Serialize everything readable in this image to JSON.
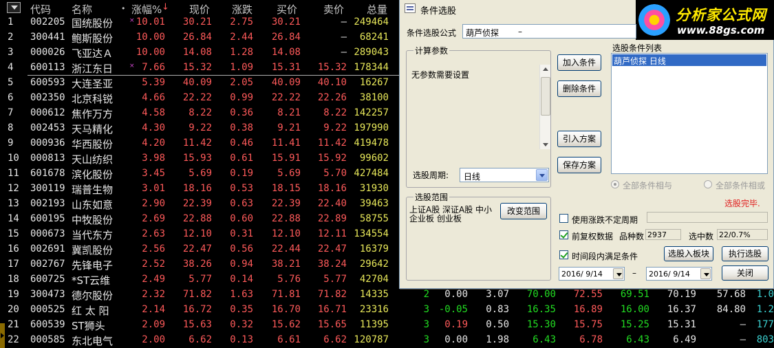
{
  "table": {
    "headers": {
      "code": "代码",
      "name": "名称",
      "dot": "•",
      "change_pct": "涨幅%",
      "price": "现价",
      "change": "涨跌",
      "bid": "买价",
      "ask": "卖价",
      "volume": "总量"
    },
    "rows": [
      {
        "no": "1",
        "code": "002205",
        "name": "国统股份",
        "mark": "×",
        "pct": "10.01",
        "price": "30.21",
        "chg": "2.75",
        "bid": "30.21",
        "ask": "–",
        "vol": "249464"
      },
      {
        "no": "2",
        "code": "300441",
        "name": "鲍斯股份",
        "mark": "",
        "pct": "10.00",
        "price": "26.84",
        "chg": "2.44",
        "bid": "26.84",
        "ask": "–",
        "vol": "68241"
      },
      {
        "no": "3",
        "code": "000026",
        "name": "飞亚达Ａ",
        "mark": "",
        "pct": "10.00",
        "price": "14.08",
        "chg": "1.28",
        "bid": "14.08",
        "ask": "–",
        "vol": "289043"
      },
      {
        "no": "4",
        "code": "600113",
        "name": "浙江东日",
        "mark": "×",
        "pct": "7.66",
        "price": "15.32",
        "chg": "1.09",
        "bid": "15.31",
        "ask": "15.32",
        "vol": "178344"
      },
      {
        "no": "5",
        "code": "600593",
        "name": "大连圣亚",
        "mark": "",
        "pct": "5.39",
        "price": "40.09",
        "chg": "2.05",
        "bid": "40.09",
        "ask": "40.10",
        "vol": "16267"
      },
      {
        "no": "6",
        "code": "002350",
        "name": "北京科锐",
        "mark": "",
        "pct": "4.66",
        "price": "22.22",
        "chg": "0.99",
        "bid": "22.22",
        "ask": "22.26",
        "vol": "38100"
      },
      {
        "no": "7",
        "code": "000612",
        "name": "焦作万方",
        "mark": "",
        "pct": "4.58",
        "price": "8.22",
        "chg": "0.36",
        "bid": "8.21",
        "ask": "8.22",
        "vol": "142257"
      },
      {
        "no": "8",
        "code": "002453",
        "name": "天马精化",
        "mark": "",
        "pct": "4.30",
        "price": "9.22",
        "chg": "0.38",
        "bid": "9.21",
        "ask": "9.22",
        "vol": "197990"
      },
      {
        "no": "9",
        "code": "000936",
        "name": "华西股份",
        "mark": "",
        "pct": "4.20",
        "price": "11.42",
        "chg": "0.46",
        "bid": "11.41",
        "ask": "11.42",
        "vol": "419478"
      },
      {
        "no": "10",
        "code": "000813",
        "name": "天山纺织",
        "mark": "",
        "pct": "3.98",
        "price": "15.93",
        "chg": "0.61",
        "bid": "15.91",
        "ask": "15.92",
        "vol": "99602"
      },
      {
        "no": "11",
        "code": "601678",
        "name": "滨化股份",
        "mark": "",
        "pct": "3.45",
        "price": "5.69",
        "chg": "0.19",
        "bid": "5.69",
        "ask": "5.70",
        "vol": "427484"
      },
      {
        "no": "12",
        "code": "300119",
        "name": "瑞普生物",
        "mark": "",
        "pct": "3.01",
        "price": "18.16",
        "chg": "0.53",
        "bid": "18.15",
        "ask": "18.16",
        "vol": "31930"
      },
      {
        "no": "13",
        "code": "002193",
        "name": "山东如意",
        "mark": "",
        "pct": "2.90",
        "price": "22.39",
        "chg": "0.63",
        "bid": "22.39",
        "ask": "22.40",
        "vol": "39463"
      },
      {
        "no": "14",
        "code": "600195",
        "name": "中牧股份",
        "mark": "",
        "pct": "2.69",
        "price": "22.88",
        "chg": "0.60",
        "bid": "22.88",
        "ask": "22.89",
        "vol": "58755"
      },
      {
        "no": "15",
        "code": "000673",
        "name": "当代东方",
        "mark": "",
        "pct": "2.63",
        "price": "12.10",
        "chg": "0.31",
        "bid": "12.10",
        "ask": "12.11",
        "vol": "134554"
      },
      {
        "no": "16",
        "code": "002691",
        "name": "冀凯股份",
        "mark": "",
        "pct": "2.56",
        "price": "22.47",
        "chg": "0.56",
        "bid": "22.44",
        "ask": "22.47",
        "vol": "16379"
      },
      {
        "no": "17",
        "code": "002767",
        "name": "先锋电子",
        "mark": "",
        "pct": "2.52",
        "price": "38.26",
        "chg": "0.94",
        "bid": "38.21",
        "ask": "38.24",
        "vol": "29642"
      },
      {
        "no": "18",
        "code": "600725",
        "name": "*ST云维",
        "mark": "",
        "pct": "2.49",
        "price": "5.77",
        "chg": "0.14",
        "bid": "5.76",
        "ask": "5.77",
        "vol": "42704"
      },
      {
        "no": "19",
        "code": "300473",
        "name": "德尔股份",
        "mark": "",
        "pct": "2.32",
        "price": "71.82",
        "chg": "1.63",
        "bid": "71.81",
        "ask": "71.82",
        "vol": "14335",
        "extra": [
          "2",
          "0.00",
          "3.07",
          "70.00",
          "72.55",
          "69.51",
          "70.19",
          "57.68",
          "1.0"
        ]
      },
      {
        "no": "20",
        "code": "000525",
        "name": "红 太 阳",
        "mark": "",
        "pct": "2.14",
        "price": "16.72",
        "chg": "0.35",
        "bid": "16.70",
        "ask": "16.71",
        "vol": "23316",
        "extra": [
          "3",
          "-0.05",
          "0.83",
          "16.35",
          "16.89",
          "16.00",
          "16.37",
          "84.80",
          "1.2"
        ]
      },
      {
        "no": "21",
        "code": "600539",
        "name": "ST狮头",
        "mark": "",
        "pct": "2.09",
        "price": "15.63",
        "chg": "0.32",
        "bid": "15.62",
        "ask": "15.65",
        "vol": "11395",
        "extra": [
          "3",
          "0.19",
          "0.50",
          "15.30",
          "15.75",
          "15.25",
          "15.31",
          "–",
          "177"
        ]
      },
      {
        "no": "22",
        "code": "000585",
        "name": "东北电气",
        "mark": "",
        "pct": "2.00",
        "price": "6.62",
        "chg": "0.13",
        "bid": "6.61",
        "ask": "6.62",
        "vol": "120787",
        "extra": [
          "3",
          "0.00",
          "1.98",
          "6.43",
          "6.78",
          "6.43",
          "6.49",
          "–",
          "803"
        ]
      }
    ]
  },
  "dialog": {
    "title": "条件选股",
    "formula_label": "条件选股公式",
    "formula_value": "葫芦侦探",
    "formula_suffix": "–",
    "params_group": "计算参数",
    "params_text": "无参数需要设置",
    "period_label": "选股周期:",
    "period_value": "日线",
    "range_group": "选股范围",
    "range_text": "上证A股 深证A股 中小企业板 创业板",
    "buttons": {
      "add": "加入条件",
      "delete": "删除条件",
      "import": "引入方案",
      "save": "保存方案",
      "change_range": "改变范围",
      "to_block": "选股入板块",
      "execute": "执行选股",
      "close": "关闭"
    },
    "list_label": "选股条件列表",
    "list_items": [
      "葫芦侦探   日线"
    ],
    "radio_and": "全部条件相与",
    "radio_or": "全部条件相或",
    "status": "选股完毕.",
    "use_uncertain": "使用涨跌不定周期",
    "prev_adjust": "前复权数据",
    "count_label": "品种数",
    "count_value": "2937",
    "selected_label": "选中数",
    "selected_value": "22/0.7%",
    "time_label": "时间段内满足条件",
    "date_from": "2016/ 9/14",
    "date_sep": "–",
    "date_to": "2016/ 9/14"
  },
  "logo": {
    "line1": "分析家公式网",
    "line2": "www.88gs.com"
  },
  "colors": {
    "red": "#ff5a5a",
    "yellow": "#e8e85a",
    "cyan": "#3cd0d0",
    "green": "#22dd22",
    "white": "#e8e8e8",
    "selection": "#316ac5"
  }
}
